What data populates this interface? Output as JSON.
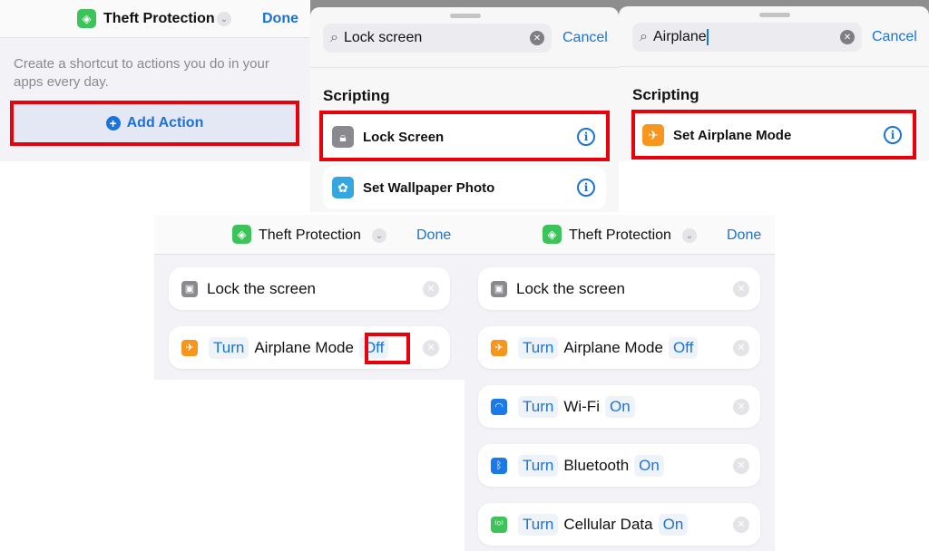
{
  "shortcut": {
    "title": "Theft Protection",
    "done": "Done"
  },
  "panel1": {
    "hint": "Create a shortcut to actions you do in your apps every day.",
    "add_action": "Add Action"
  },
  "panel2": {
    "search": "Lock screen",
    "cancel": "Cancel",
    "section": "Scripting",
    "results": [
      {
        "label": "Lock Screen",
        "icon": "lock-icon"
      },
      {
        "label": "Set Wallpaper Photo",
        "icon": "wallpaper-icon"
      }
    ]
  },
  "panel3": {
    "search": "Airplane",
    "cancel": "Cancel",
    "section": "Scripting",
    "results": [
      {
        "label": "Set Airplane Mode",
        "icon": "airplane-icon"
      }
    ]
  },
  "actions": {
    "lock": "Lock the screen",
    "turn": "Turn",
    "airplane": "Airplane Mode",
    "wifi": "Wi-Fi",
    "bluetooth": "Bluetooth",
    "cellular": "Cellular Data",
    "off": "Off",
    "on": "On"
  },
  "colors": {
    "accent": "#1a73d9",
    "highlight": "#e8000b",
    "app": "#3cc35a",
    "airplane": "#f7961e",
    "wifi": "#1a7ae8",
    "cellular": "#3cc35a"
  }
}
